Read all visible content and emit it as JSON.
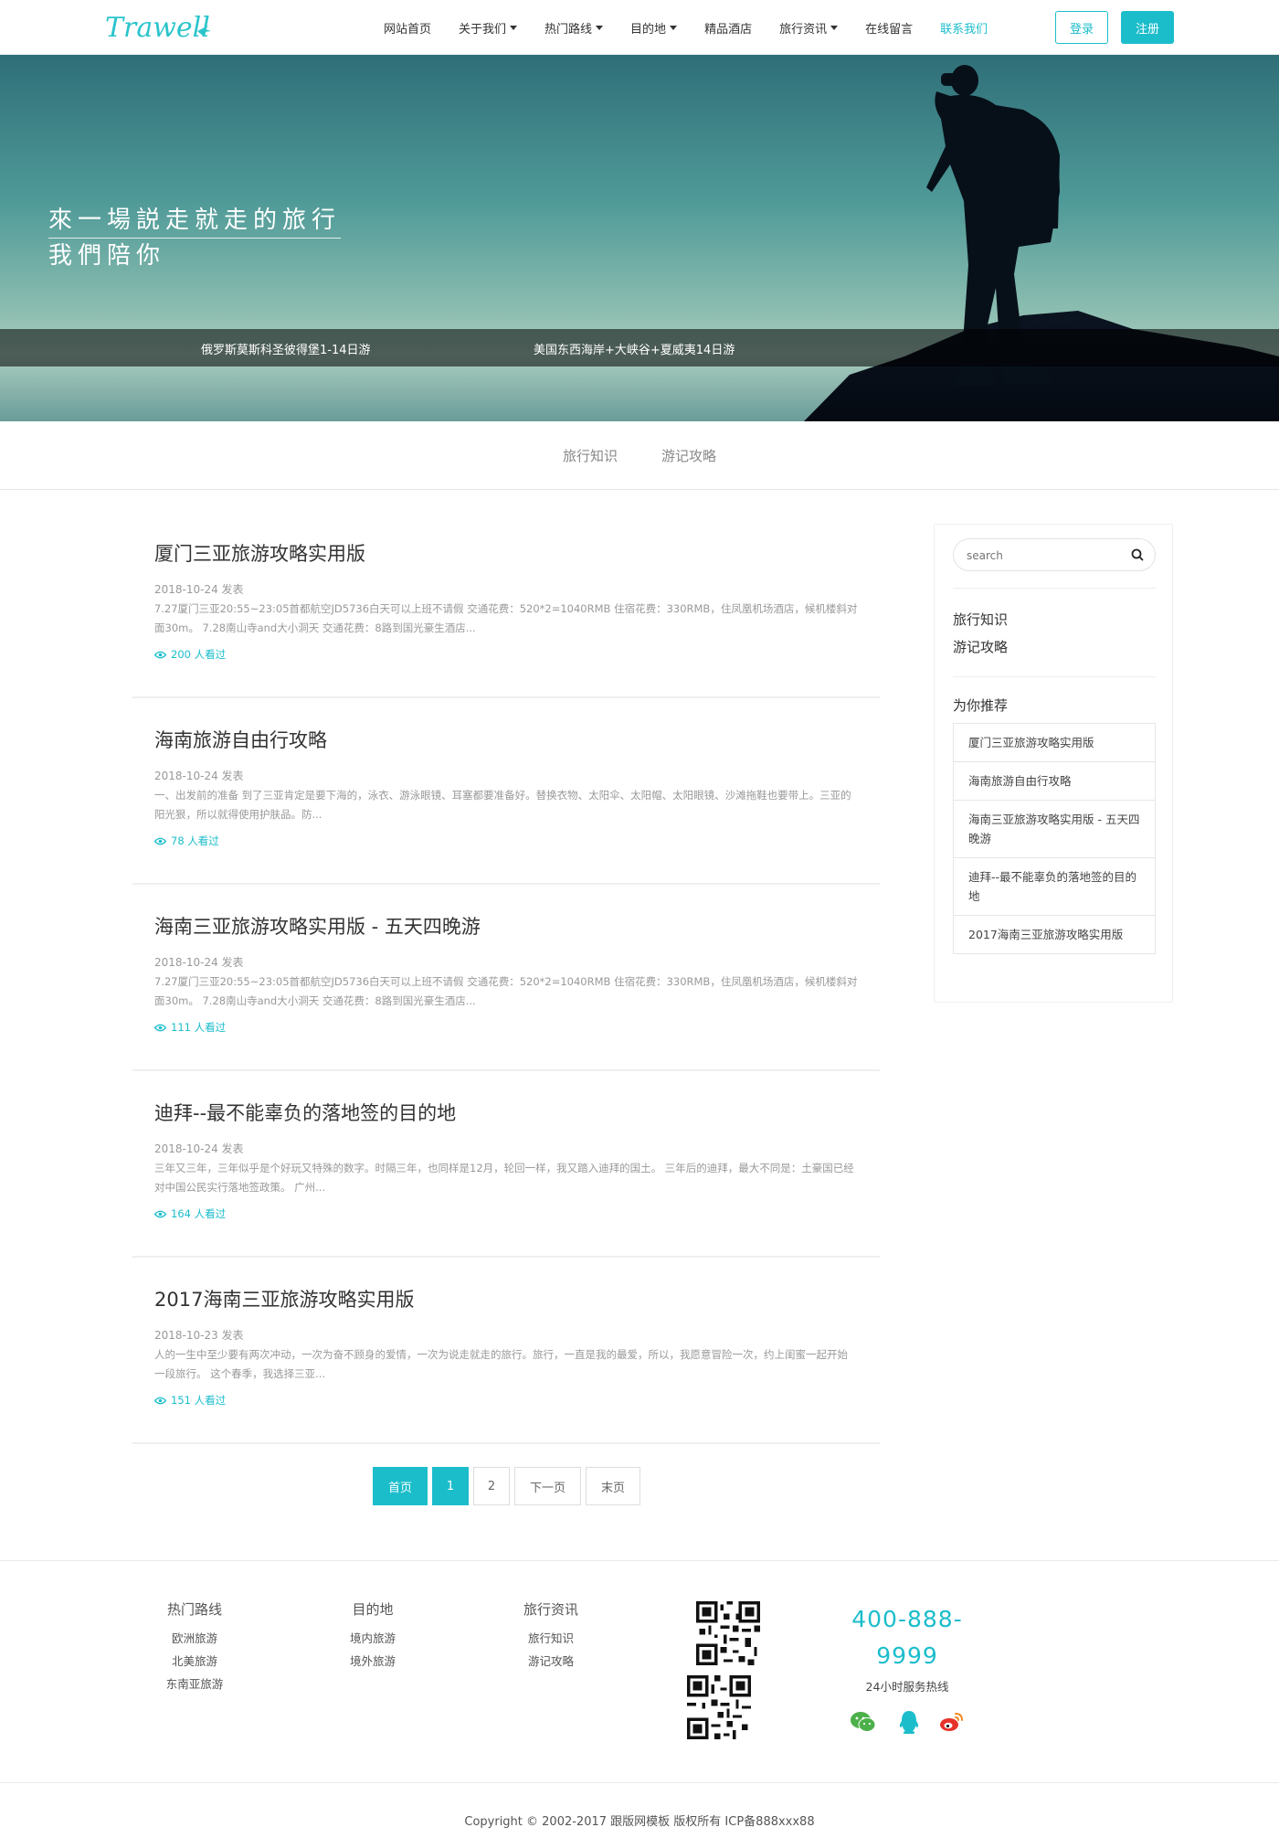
{
  "brand": {
    "logo_text": "Trawell",
    "accent": "#1bbdcb"
  },
  "nav": {
    "items": [
      {
        "label": "网站首页",
        "dropdown": false,
        "active": false
      },
      {
        "label": "关于我们",
        "dropdown": true,
        "active": false
      },
      {
        "label": "热门路线",
        "dropdown": true,
        "active": false
      },
      {
        "label": "目的地",
        "dropdown": true,
        "active": false
      },
      {
        "label": "精品酒店",
        "dropdown": false,
        "active": false
      },
      {
        "label": "旅行资讯",
        "dropdown": true,
        "active": false
      },
      {
        "label": "在线留言",
        "dropdown": false,
        "active": false
      },
      {
        "label": "联系我们",
        "dropdown": false,
        "active": true
      }
    ],
    "login_label": "登录",
    "register_label": "注册"
  },
  "hero": {
    "title_line1": "來一場説走就走的旅行",
    "title_line2": "我們陪你",
    "captions": [
      "俄罗斯莫斯科圣彼得堡1-14日游",
      "美国东西海岸+大峡谷+夏威夷14日游"
    ]
  },
  "category_tabs": [
    "旅行知识",
    "游记攻略"
  ],
  "articles": [
    {
      "title": "厦门三亚旅游攻略实用版",
      "date": "2018-10-24 发表",
      "excerpt": "7.27厦门三亚20:55~23:05首都航空JD5736白天可以上班不请假 交通花费：520*2=1040RMB 住宿花费：330RMB，住凤凰机场酒店，候机楼斜对面30m。 7.28南山寺and大小洞天 交通花费：8路到国光豪生酒店...",
      "views": "200 人看过"
    },
    {
      "title": "海南旅游自由行攻略",
      "date": "2018-10-24 发表",
      "excerpt": "一、出发前的准备 到了三亚肯定是要下海的，泳衣、游泳眼镜、耳塞都要准备好。替换衣物、太阳伞、太阳帽、太阳眼镜、沙滩拖鞋也要带上。三亚的阳光狠，所以就得使用护肤品。防...",
      "views": "78 人看过"
    },
    {
      "title": "海南三亚旅游攻略实用版 - 五天四晚游",
      "date": "2018-10-24 发表",
      "excerpt": "7.27厦门三亚20:55~23:05首都航空JD5736白天可以上班不请假 交通花费：520*2=1040RMB 住宿花费：330RMB，住凤凰机场酒店，候机楼斜对面30m。 7.28南山寺and大小洞天 交通花费：8路到国光豪生酒店...",
      "views": "111 人看过"
    },
    {
      "title": "迪拜--最不能辜负的落地签的目的地",
      "date": "2018-10-24 发表",
      "excerpt": "三年又三年，三年似乎是个好玩又特殊的数字。时隔三年，也同样是12月，轮回一样，我又踏入迪拜的国土。 三年后的迪拜，最大不同是：土豪国已经对中国公民实行落地签政策。 广州...",
      "views": "164 人看过"
    },
    {
      "title": "2017海南三亚旅游攻略实用版",
      "date": "2018-10-23 发表",
      "excerpt": "人的一生中至少要有两次冲动，一次为奋不顾身的爱情，一次为说走就走的旅行。旅行，一直是我的最爱，所以，我愿意冒险一次，约上闺蜜一起开始一段旅行。 这个春季，我选择三亚...",
      "views": "151 人看过"
    }
  ],
  "pagination": {
    "first": "首页",
    "pages": [
      "1",
      "2"
    ],
    "current": "1",
    "next": "下一页",
    "last": "末页"
  },
  "sidebar": {
    "search_placeholder": "search",
    "categories": [
      "旅行知识",
      "游记攻略"
    ],
    "recommend_title": "为你推荐",
    "recommend": [
      "厦门三亚旅游攻略实用版",
      "海南旅游自由行攻略",
      "海南三亚旅游攻略实用版 - 五天四晚游",
      "迪拜--最不能辜负的落地签的目的地",
      "2017海南三亚旅游攻略实用版"
    ]
  },
  "footer": {
    "columns": [
      {
        "title": "热门路线",
        "links": [
          "欧洲旅游",
          "北美旅游",
          "东南亚旅游"
        ]
      },
      {
        "title": "目的地",
        "links": [
          "境内旅游",
          "境外旅游"
        ]
      },
      {
        "title": "旅行资讯",
        "links": [
          "旅行知识",
          "游记攻略"
        ]
      }
    ],
    "phone_line1": "400-888-",
    "phone_line2": "9999",
    "hotline_label": "24小时服务热线",
    "social_icons": [
      "wechat-icon",
      "qq-icon",
      "weibo-icon"
    ],
    "copyright": "Copyright © 2002-2017 跟版网模板 版权所有 ICP备888xxx88"
  }
}
